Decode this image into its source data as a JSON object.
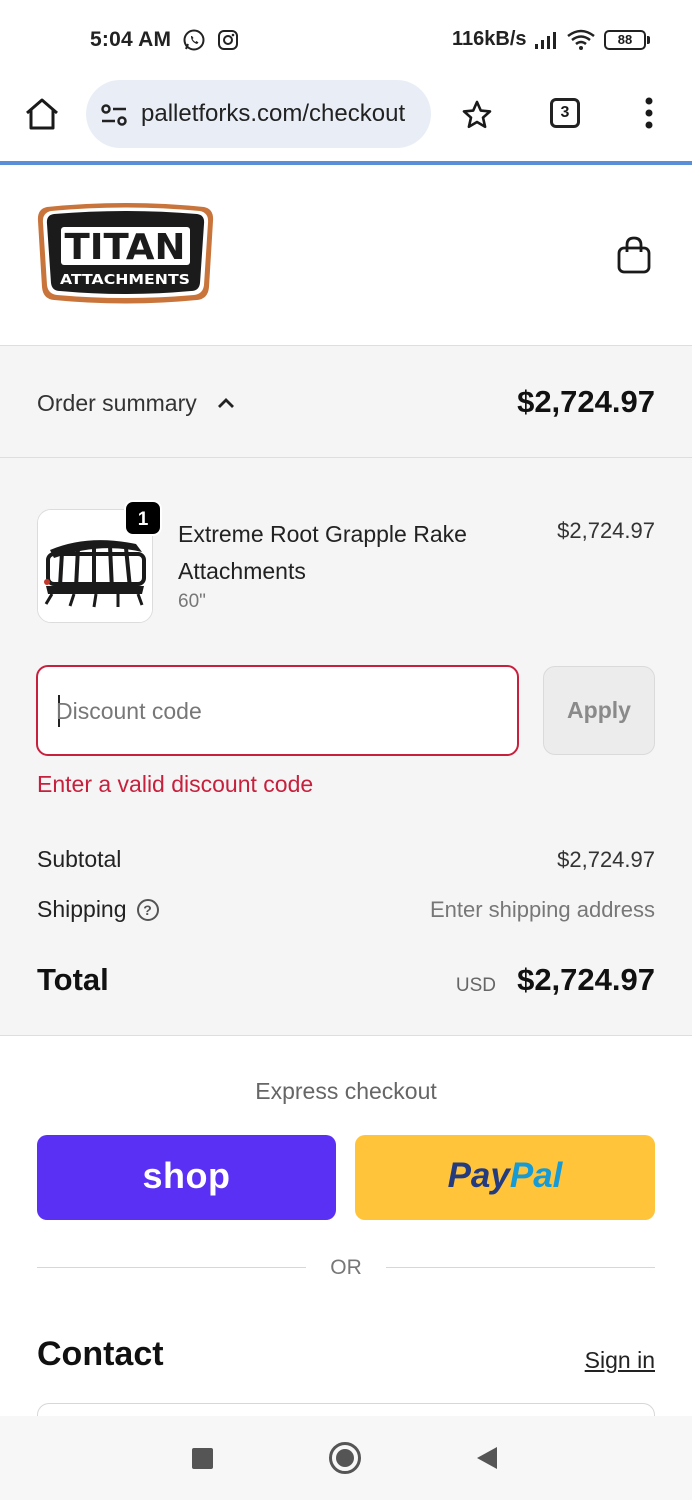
{
  "status_bar": {
    "time": "5:04 AM",
    "network_speed": "116kB/s",
    "battery": "88",
    "icons": [
      "whatsapp-icon",
      "instagram-icon",
      "signal-icon",
      "wifi-icon",
      "battery-icon"
    ]
  },
  "browser": {
    "url": "palletforks.com/checkout",
    "tab_count": "3",
    "icons": [
      "home-icon",
      "site-settings-icon",
      "star-icon",
      "tabs-icon",
      "more-vert-icon"
    ]
  },
  "header": {
    "logo_line1": "TITAN",
    "logo_line2": "ATTACHMENTS",
    "cart_icon": "shopping-bag-icon"
  },
  "order_summary": {
    "label": "Order summary",
    "total": "$2,724.97",
    "toggle_icon": "chevron-up-icon"
  },
  "line_item": {
    "quantity": "1",
    "name": "Extreme Root Grapple Rake Attachments",
    "variant": "60\"",
    "price": "$2,724.97"
  },
  "discount": {
    "placeholder": "Discount code",
    "value": "",
    "apply_label": "Apply",
    "error": "Enter a valid discount code"
  },
  "totals": {
    "subtotal_label": "Subtotal",
    "subtotal_value": "$2,724.97",
    "shipping_label": "Shipping",
    "shipping_value": "Enter shipping address",
    "total_label": "Total",
    "currency": "USD",
    "total_value": "$2,724.97"
  },
  "express": {
    "title": "Express checkout",
    "shop_label": "shop",
    "paypal_part1": "Pay",
    "paypal_part2": "Pal",
    "or_label": "OR"
  },
  "contact": {
    "title": "Contact",
    "sign_in": "Sign in"
  },
  "colors": {
    "error": "#c6203d",
    "shop_purple": "#5a31f4",
    "paypal_yellow": "#ffc439",
    "summary_bg": "#f5f5f5"
  }
}
